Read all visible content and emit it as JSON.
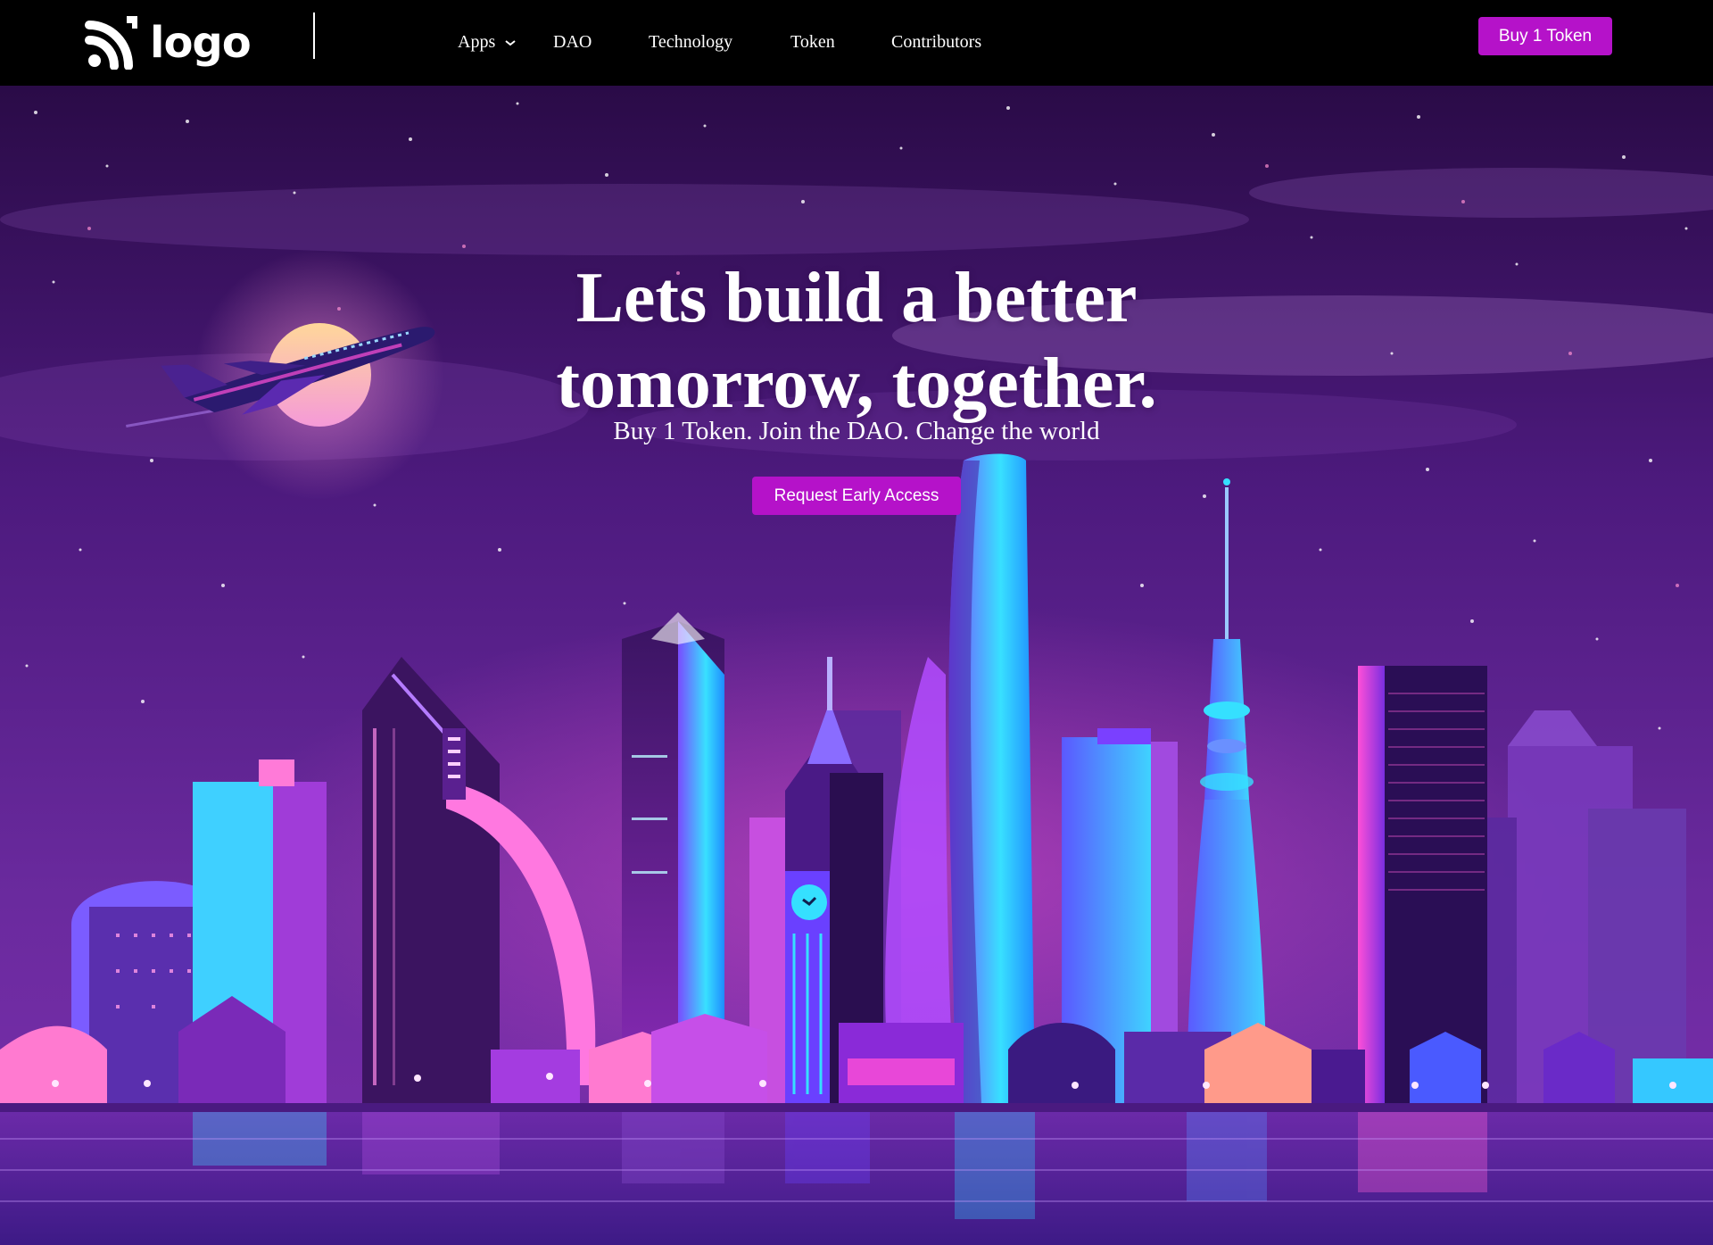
{
  "nav": {
    "logo_text": "logo",
    "items": [
      {
        "label": "Apps",
        "has_dropdown": true
      },
      {
        "label": "DAO"
      },
      {
        "label": "Technology"
      },
      {
        "label": "Token"
      },
      {
        "label": "Contributors"
      }
    ],
    "buy_label": "Buy 1 Token"
  },
  "hero": {
    "title_line1": "Lets build a better",
    "title_line2": "tomorrow, together.",
    "subtitle": "Buy 1 Token. Join the DAO. Change the world",
    "cta_label": "Request Early Access"
  },
  "colors": {
    "accent": "#b512c9",
    "nav_bg": "#000000",
    "sky_top": "#2a0b47",
    "sky_mid": "#5a2190",
    "neon_cyan": "#35d6ff",
    "neon_pink": "#ff3bd1"
  },
  "icons": {
    "logo": "signal-arcs-icon",
    "dropdown": "chevron-down-icon",
    "illustration": "neon-city-skyline"
  }
}
